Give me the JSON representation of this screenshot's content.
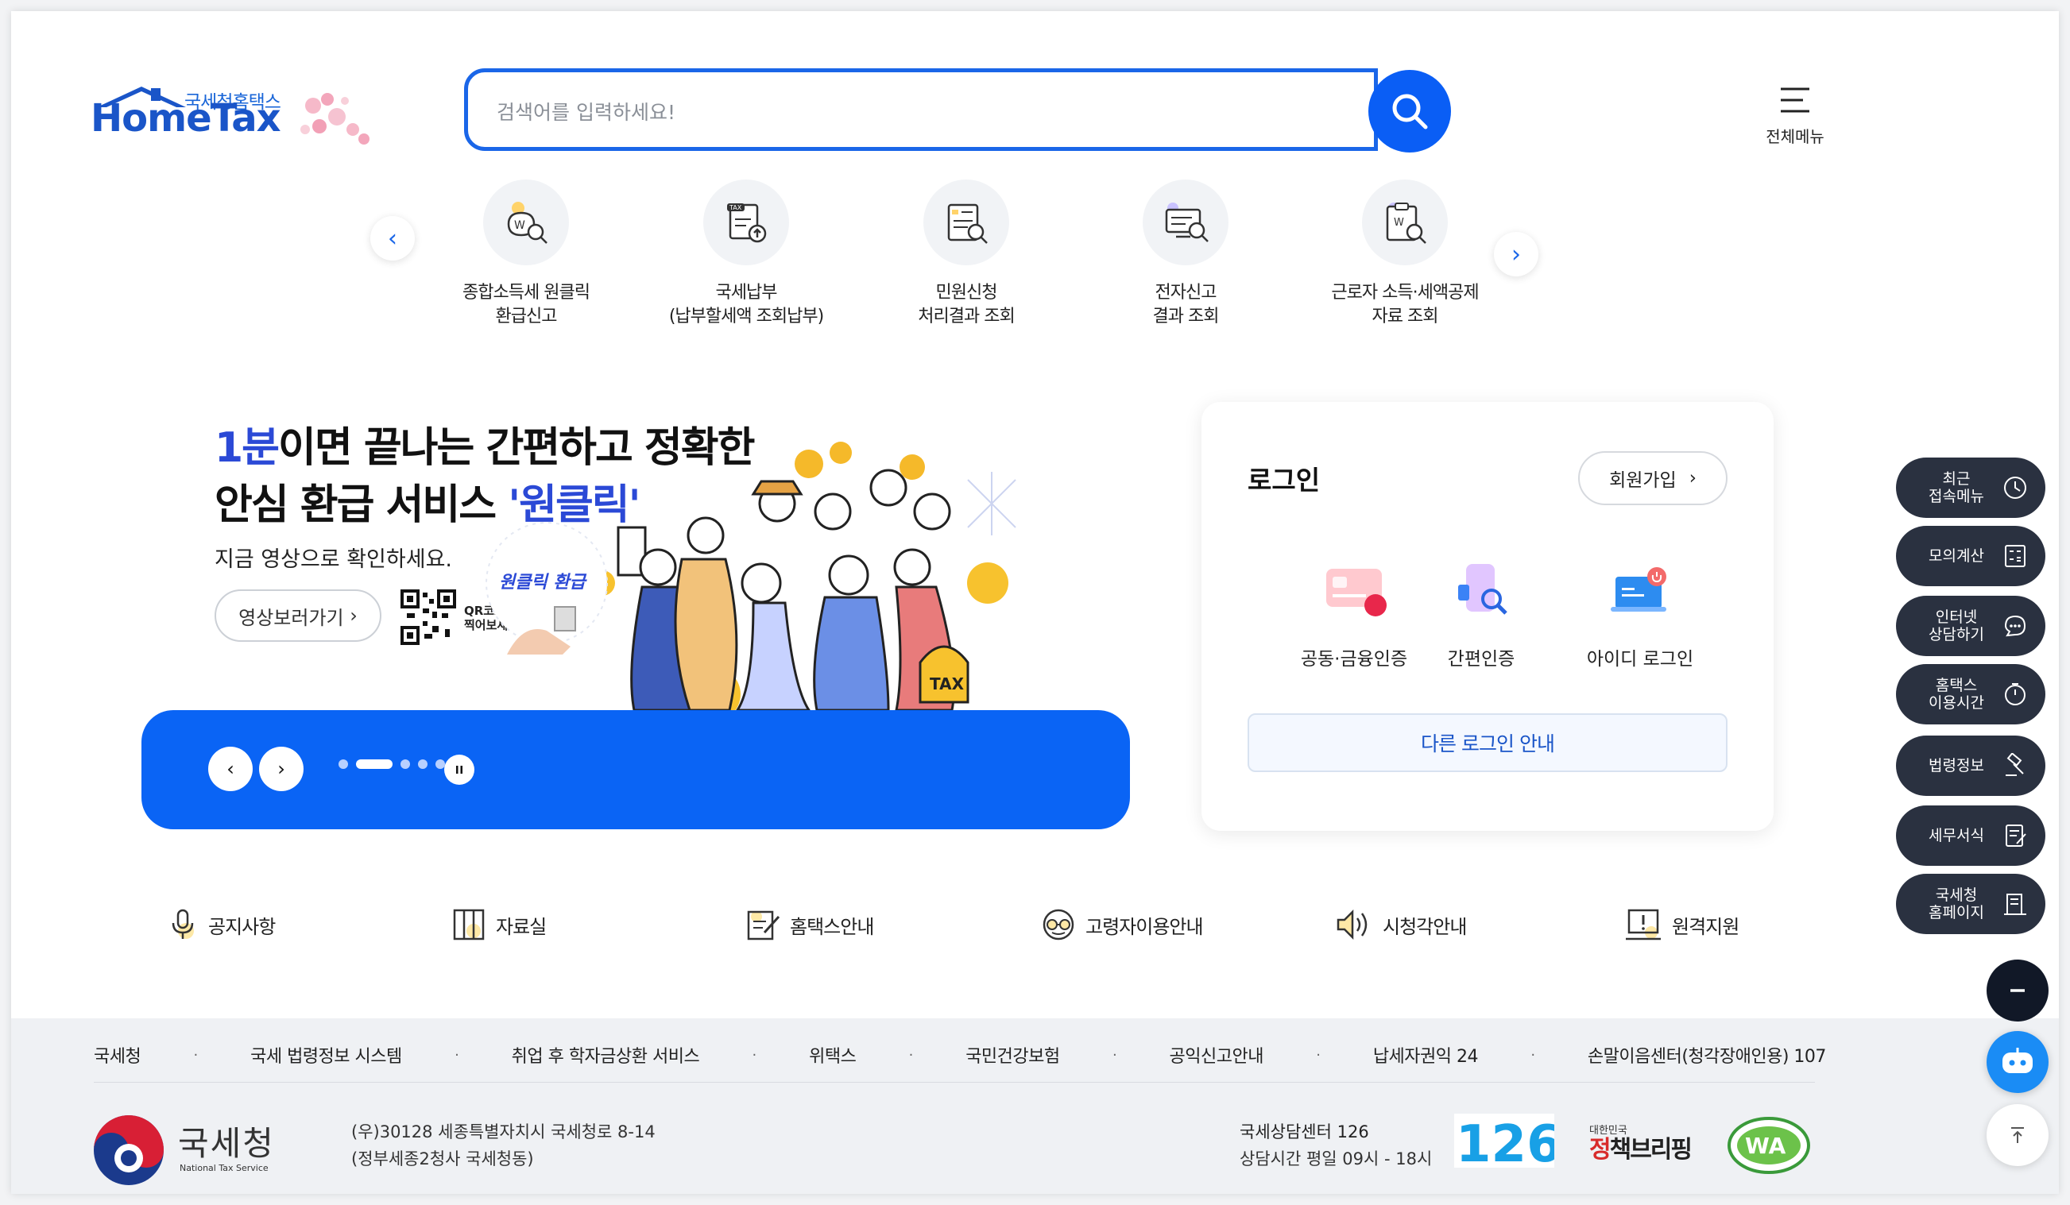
{
  "brand": {
    "sub": "국세청홈택스",
    "main": "HomeTax"
  },
  "search": {
    "placeholder": "검색어를 입력하세요!"
  },
  "header": {
    "all_menu": "전체메뉴"
  },
  "quick": [
    {
      "line1": "종합소득세 원클릭",
      "line2": "환급신고",
      "icon": "tax-refund-icon"
    },
    {
      "line1": "국세납부",
      "line2": "(납부할세액 조회납부)",
      "icon": "tax-payment-icon"
    },
    {
      "line1": "민원신청",
      "line2": "처리결과 조회",
      "icon": "civil-request-icon"
    },
    {
      "line1": "전자신고",
      "line2": "결과 조회",
      "icon": "e-filing-icon"
    },
    {
      "line1": "근로자 소득·세액공제",
      "line2": "자료 조회",
      "icon": "deduction-data-icon"
    }
  ],
  "banner": {
    "hl1": "1분",
    "t1": "이면 끝나는 간편하고 정확한",
    "t2a": "안심 환급 서비스 ",
    "hl2": "'원클릭'",
    "desc": "지금 영상으로 확인하세요.",
    "video_btn": "영상보러가기",
    "qr_1": "QR코드를",
    "qr_2": "찍어보세요.",
    "badge": "원클릭 환급",
    "tax_bag": "TAX",
    "slides_total": 5,
    "slide_current": 2,
    "accent": "#0a64f5"
  },
  "login": {
    "title": "로그인",
    "join": "회원가입",
    "methods": [
      "공동·금융인증",
      "간편인증",
      "아이디 로그인"
    ],
    "other": "다른 로그인 안내"
  },
  "links": [
    "공지사항",
    "자료실",
    "홈택스안내",
    "고령자이용안내",
    "시청각안내",
    "원격지원"
  ],
  "footer": {
    "links": [
      "국세청",
      "국세 법령정보 시스템",
      "취업 후 학자금상환 서비스",
      "위택스",
      "국민건강보험",
      "공익신고안내",
      "납세자권익 24",
      "손말이음센터(청각장애인용) 107"
    ],
    "org_ko": "국세청",
    "org_en": "National Tax Service",
    "addr1": "(우)30128 세종특별자치시 국세청로 8-14",
    "addr2": "(정부세종2청사 국세청동)",
    "center": "국세상담센터 126",
    "hours": "상담시간 평일 09시 - 18시",
    "num": "126",
    "brief_small": "대한민국",
    "brief_a": "정",
    "brief_b": "책브리핑",
    "wa": "WA"
  },
  "side": [
    {
      "l1": "최근",
      "l2": "접속메뉴",
      "icon": "clock-icon"
    },
    {
      "l1": "모의계산",
      "l2": "",
      "icon": "calculator-icon"
    },
    {
      "l1": "인터넷",
      "l2": "상담하기",
      "icon": "chat-icon"
    },
    {
      "l1": "홈택스",
      "l2": "이용시간",
      "icon": "timer-icon"
    },
    {
      "l1": "법령정보",
      "l2": "",
      "icon": "gavel-icon"
    },
    {
      "l1": "세무서식",
      "l2": "",
      "icon": "form-icon"
    },
    {
      "l1": "국세청",
      "l2": "홈페이지",
      "icon": "building-icon"
    }
  ]
}
